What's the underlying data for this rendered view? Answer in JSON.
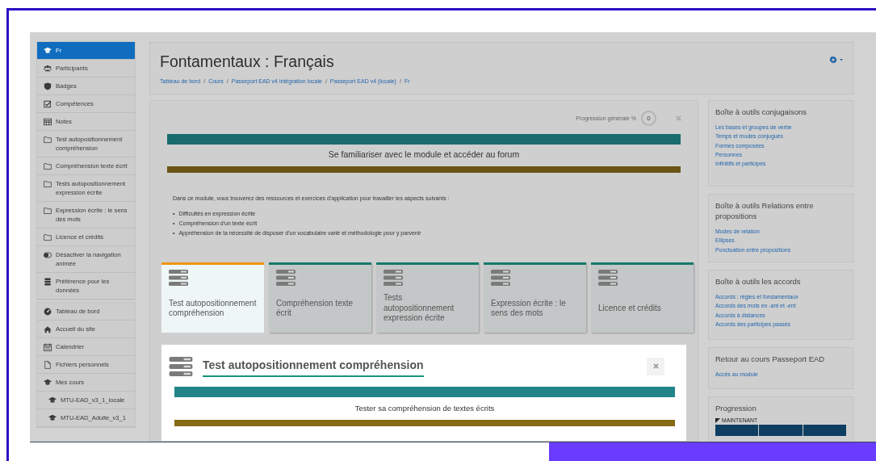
{
  "sidebar": {
    "groups": [
      {
        "items": [
          {
            "label": "Fr",
            "kind": "cap",
            "selected": true
          },
          {
            "label": "Participants",
            "kind": "users",
            "selected": false
          },
          {
            "label": "Badges",
            "kind": "shield",
            "selected": false
          },
          {
            "label": "Compétences",
            "kind": "check",
            "selected": false
          },
          {
            "label": "Notes",
            "kind": "table",
            "selected": false
          },
          {
            "label": "Test autopositionnement compréhension",
            "kind": "folder",
            "selected": false
          },
          {
            "label": "Compréhension texte écrit",
            "kind": "folder",
            "selected": false
          },
          {
            "label": "Tests autopositionnement expression écrite",
            "kind": "folder",
            "selected": false
          },
          {
            "label": "Expression écrite : le sens des mots",
            "kind": "folder",
            "selected": false
          },
          {
            "label": "Licence et crédits",
            "kind": "folder",
            "selected": false
          },
          {
            "label": "Désactiver la navigation animée",
            "kind": "toggle",
            "selected": false
          },
          {
            "label": "Préférence pour les données",
            "kind": "database",
            "selected": false
          }
        ]
      },
      {
        "items": [
          {
            "label": "Tableau de bord",
            "kind": "dashboard",
            "selected": false
          },
          {
            "label": "Accueil du site",
            "kind": "home",
            "selected": false
          },
          {
            "label": "Calendrier",
            "kind": "calendar",
            "selected": false
          },
          {
            "label": "Fichiers personnels",
            "kind": "file",
            "selected": false
          },
          {
            "label": "Mes cours",
            "kind": "cap",
            "selected": false,
            "children": [
              {
                "label": "MTU-EAD_v3_1_locale",
                "kind": "cap",
                "selected": false
              },
              {
                "label": "MTU-EAD_Adulte_v3_1",
                "kind": "cap",
                "selected": false
              }
            ]
          }
        ]
      }
    ]
  },
  "header": {
    "title": "Fontamentaux : Français",
    "breadcrumbs": [
      {
        "label": "Tableau de bord",
        "separator": "/"
      },
      {
        "label": "Cours",
        "separator": "/"
      },
      {
        "label": "Passeport EAD v4 intégration locale",
        "separator": "/"
      },
      {
        "label": "Passeport EAD v4 (locale)",
        "separator": "/"
      },
      {
        "label": "Fr"
      }
    ]
  },
  "course": {
    "progress": {
      "label": "Progression générale %",
      "value": "0"
    },
    "section_title": "Se familiariser avec le module et accéder au forum",
    "intro": "Dans ce module, vous trouverez des ressources et exercices d'application pour travailler les aspects suivants :",
    "bullets": [
      {
        "marker": "•",
        "text": "Difficultés en expression écrite"
      },
      {
        "marker": "•",
        "text": "Compréhension d'un texte écrit"
      },
      {
        "marker": "•",
        "text": "Appréhension de la nécessité de disposer d'un vocabulaire varié et méthodologie pour y parvenir"
      }
    ],
    "tiles": [
      {
        "label": "Test autopositionnement compréhension",
        "selected": true
      },
      {
        "label": "Compréhension texte écrit",
        "selected": false
      },
      {
        "label": "Tests autopositionnement expression écrite",
        "selected": false
      },
      {
        "label": "Expression écrite : le sens des mots",
        "selected": false
      },
      {
        "label": "Licence et crédits",
        "selected": false
      }
    ],
    "open_section": {
      "title": "Test autopositionnement compréhension",
      "subtitle": "Tester sa compréhension de textes écrits"
    }
  },
  "blocks": [
    {
      "kind": "links",
      "title": "Boîte à outils conjugaisons",
      "links": [
        "Les bases et groupes de verbe",
        "Temps et modes conjugués",
        "Formes composées",
        "Personnes",
        "Infinitifs et participes"
      ]
    },
    {
      "kind": "links",
      "title": "Boîte à outils Relations entre propositions",
      "links": [
        "Modes de relation",
        "Ellipses",
        "Ponctuation entre propositions"
      ]
    },
    {
      "kind": "links",
      "title": "Boîte à outils les accords",
      "links": [
        "Accords : règles et fondamentaux",
        "Accords des mots en -ant et -ent",
        "Accords à distances",
        "Accords des participes passés"
      ]
    },
    {
      "kind": "links",
      "title": "Retour au cours Passeport EAD",
      "links": [
        "Accès au module"
      ]
    },
    {
      "kind": "progress",
      "title": "Progression",
      "now_label": "MAINTENANT"
    }
  ]
}
